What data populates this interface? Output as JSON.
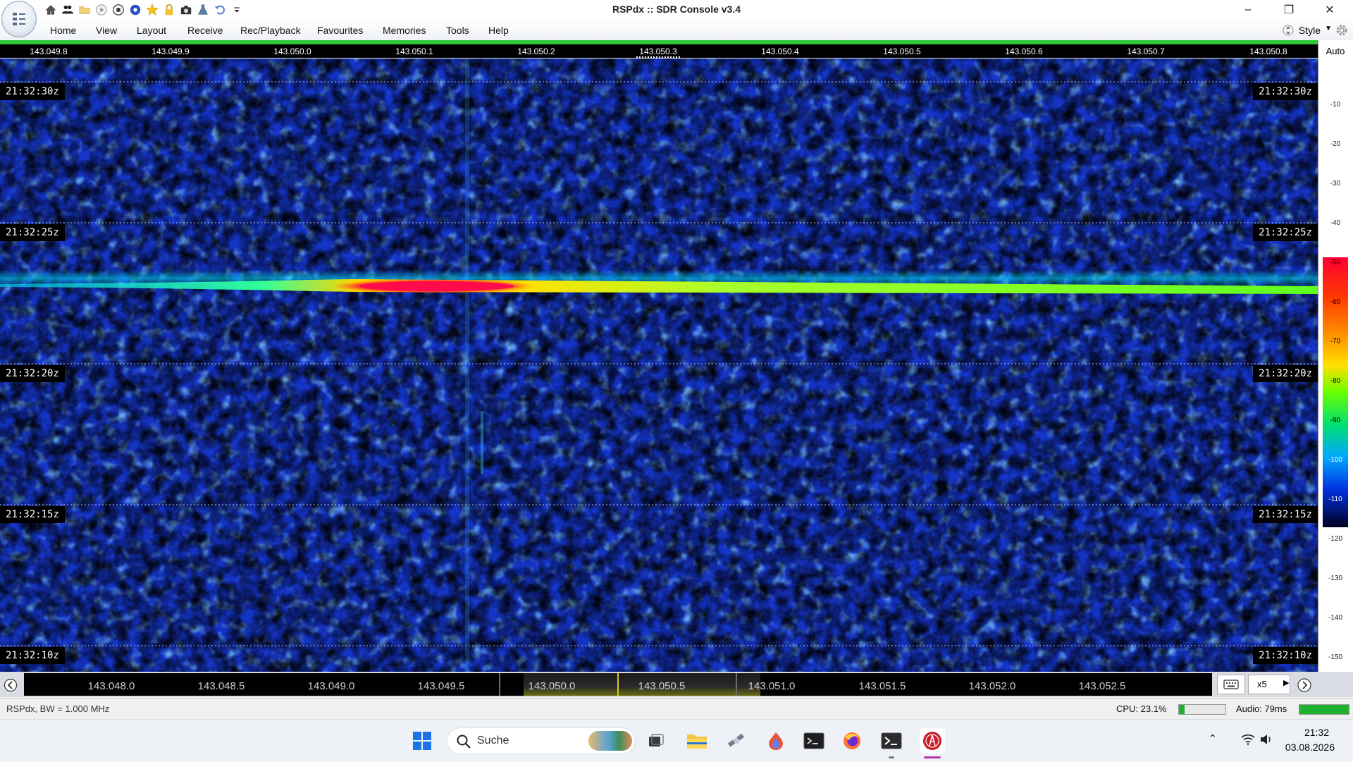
{
  "window": {
    "title": "RSPdx :: SDR Console v3.4",
    "controls": [
      "minimize-icon",
      "restore-icon",
      "close-icon"
    ]
  },
  "quick_access": {
    "icons": [
      "home-icon",
      "users-icon",
      "folder-icon",
      "play-icon",
      "stop-icon",
      "target-icon",
      "star-icon",
      "lock-icon",
      "camera-icon",
      "flask-icon",
      "undo-icon",
      "dropdown-icon"
    ]
  },
  "menu": {
    "items": [
      "Home",
      "View",
      "Layout",
      "Receive",
      "Rec/Playback",
      "Favourites",
      "Memories",
      "Tools",
      "Help"
    ],
    "style_label": "Style"
  },
  "top_ruler": {
    "ticks": [
      "143.049.8",
      "143.049.9",
      "143.050.0",
      "143.050.1",
      "143.050.2",
      "143.050.3",
      "143.050.4",
      "143.050.5",
      "143.050.6",
      "143.050.7",
      "143.050.8"
    ]
  },
  "waterfall": {
    "time_labels": [
      "21:32:30z",
      "21:32:25z",
      "21:32:20z",
      "21:32:15z",
      "21:32:10z"
    ],
    "colors": {
      "background": "#1535c8",
      "noise_light": "#3aa6ff",
      "noise_dark": "#050a55",
      "signal_hot": "#e8003a",
      "signal_warm": "#ffd400",
      "signal_cool": "#33ff66"
    }
  },
  "scale": {
    "auto_label": "Auto",
    "ticks": [
      "-10",
      "-20",
      "-30",
      "-40",
      "-50",
      "-60",
      "-70",
      "-80",
      "-90",
      "-100",
      "-110",
      "-120",
      "-130",
      "-140",
      "-150"
    ]
  },
  "bottom_ruler": {
    "ticks": [
      "143.048.0",
      "143.048.5",
      "143.049.0",
      "143.049.5",
      "143.050.0",
      "143.050.5",
      "143.051.0",
      "143.051.5",
      "143.052.0",
      "143.052.5"
    ],
    "zoom": "x5"
  },
  "status": {
    "device": "RSPdx, BW = 1.000 MHz",
    "cpu": "CPU: 23.1%",
    "cpu_level": 0.12,
    "audio": "Audio: 79ms",
    "audio_level": 1.0
  },
  "taskbar": {
    "search_placeholder": "Suche",
    "time": "21:32",
    "date": "03.08.2026",
    "apps": [
      "windows-start-icon",
      "task-view-icon",
      "file-explorer-icon",
      "satellite-app-icon",
      "flame-app-icon",
      "terminal-icon",
      "firefox-icon",
      "powershell-icon",
      "sdr-console-icon"
    ]
  }
}
